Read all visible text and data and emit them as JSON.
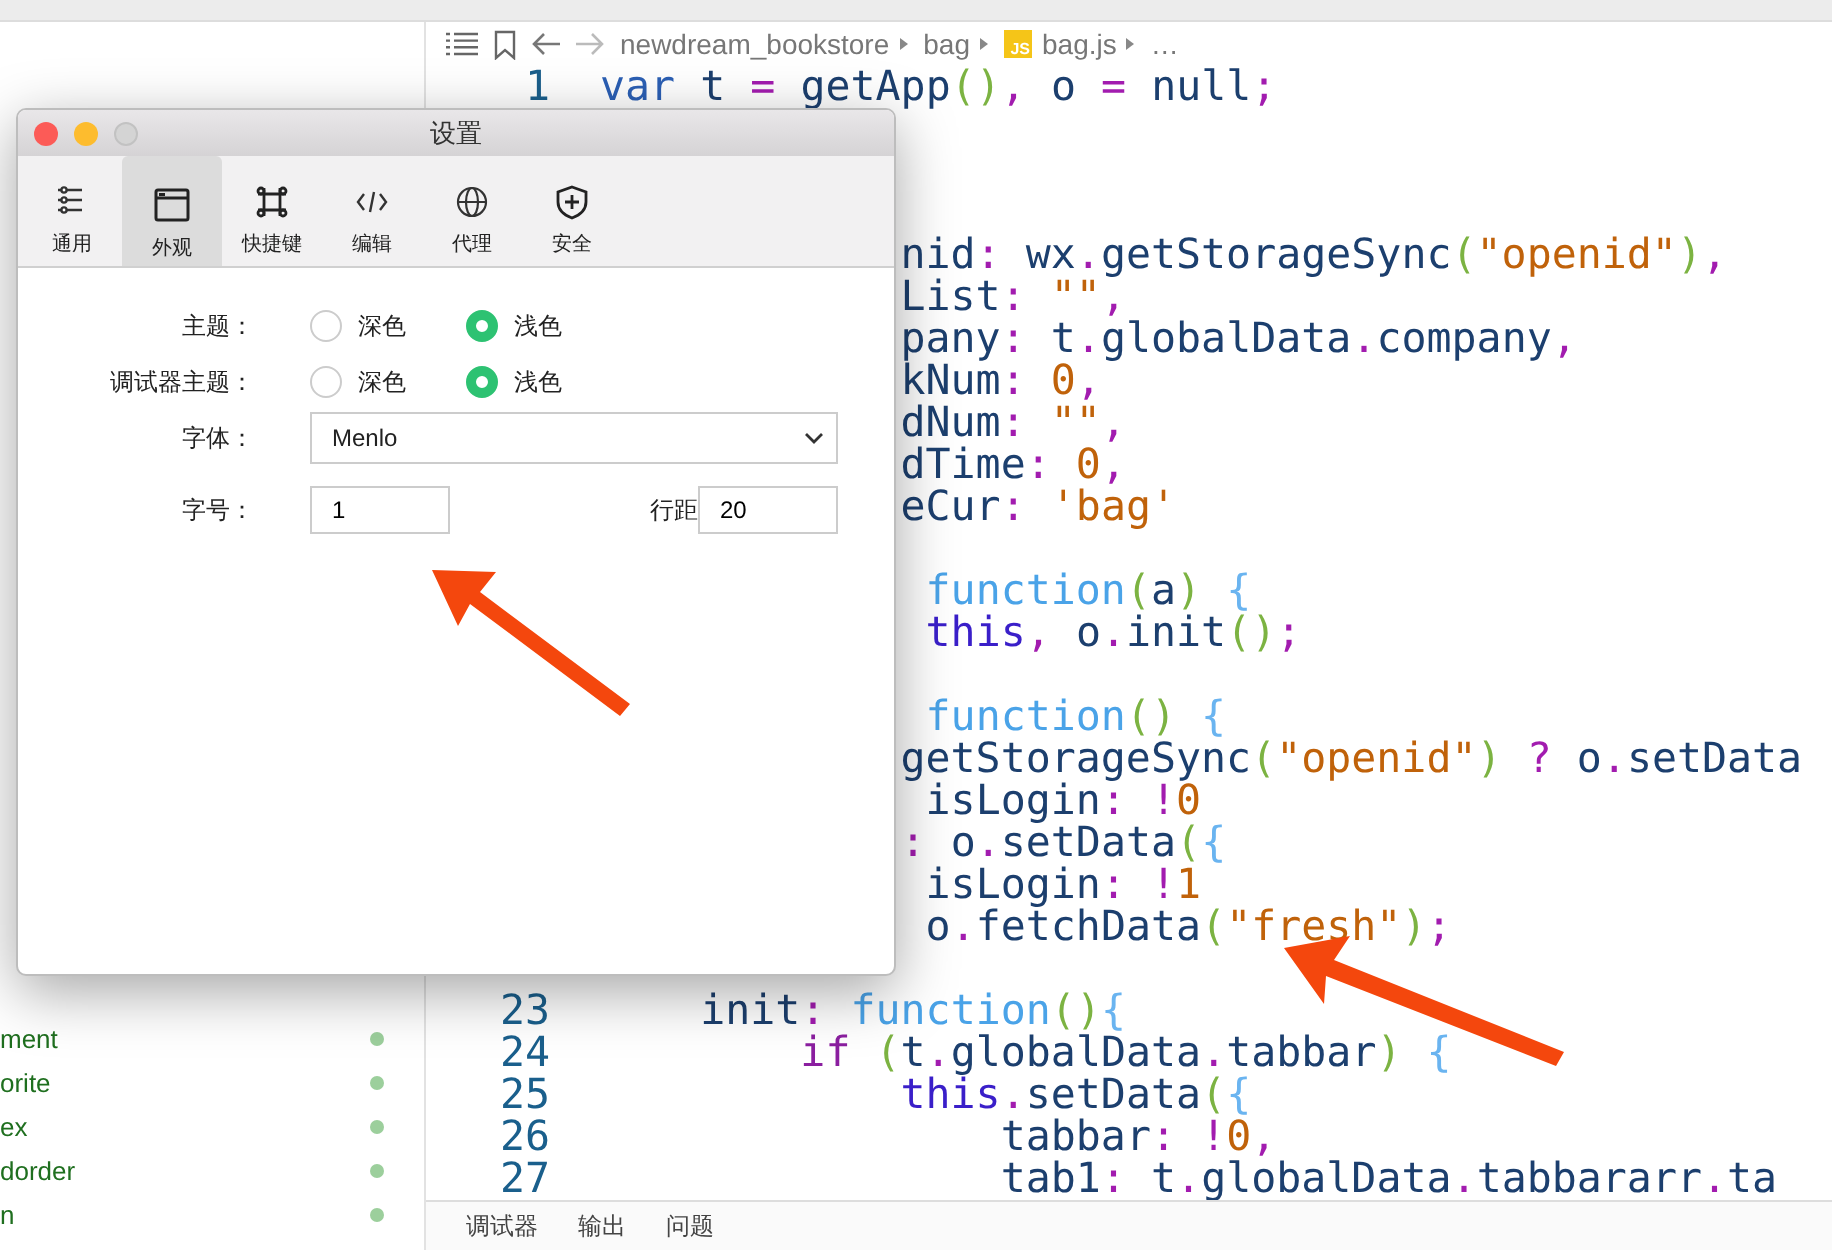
{
  "breadcrumb": [
    {
      "kind": "folder",
      "text": "newdream_bookstore"
    },
    {
      "kind": "folder",
      "text": "bag"
    },
    {
      "kind": "file",
      "text": "bag.js",
      "badge": "JS"
    },
    {
      "kind": "more",
      "text": "…"
    }
  ],
  "editor": {
    "lines": [
      {
        "kind": "code",
        "number": "1",
        "text": "var t = getApp(), o = null;"
      },
      {
        "kind": "blank"
      },
      {
        "kind": "blank"
      },
      {
        "kind": "blank"
      },
      {
        "kind": "code",
        "text": "            nid: wx.getStorageSync(\"openid\"),"
      },
      {
        "kind": "code",
        "text": "            List: \"\","
      },
      {
        "kind": "code",
        "text": "            pany: t.globalData.company,"
      },
      {
        "kind": "code",
        "text": "            kNum: 0,"
      },
      {
        "kind": "code",
        "text": "            dNum: \"\","
      },
      {
        "kind": "code",
        "text": "            dTime: 0,"
      },
      {
        "kind": "code",
        "text": "            eCur: 'bag'"
      },
      {
        "kind": "blank"
      },
      {
        "kind": "code",
        "text": "             function(a) {"
      },
      {
        "kind": "code",
        "text": "             this, o.init();"
      },
      {
        "kind": "blank"
      },
      {
        "kind": "code",
        "text": "             function() {"
      },
      {
        "kind": "code",
        "text": "            getStorageSync(\"openid\") ? o.setData"
      },
      {
        "kind": "code",
        "text": "             isLogin: !0"
      },
      {
        "kind": "code",
        "text": "            : o.setData({"
      },
      {
        "kind": "code",
        "text": "             isLogin: !1"
      },
      {
        "kind": "code",
        "text": "             o.fetchData(\"fresh\");"
      },
      {
        "kind": "blank"
      },
      {
        "kind": "code",
        "number": "23",
        "text": "    init: function(){"
      },
      {
        "kind": "code",
        "number": "24",
        "text": "        if (t.globalData.tabbar) {"
      },
      {
        "kind": "code",
        "number": "25",
        "text": "            this.setData({"
      },
      {
        "kind": "code",
        "number": "26",
        "text": "                tabbar: !0,"
      },
      {
        "kind": "code",
        "number": "27",
        "text": "                tab1: t.globalData.tabbararr.ta"
      }
    ]
  },
  "sidebar": {
    "items": [
      {
        "label": "ment"
      },
      {
        "label": "orite"
      },
      {
        "label": "ex"
      },
      {
        "label": "dorder"
      },
      {
        "label": "n"
      }
    ]
  },
  "bottom_panel": {
    "tabs": [
      {
        "label": "调试器"
      },
      {
        "label": "输出"
      },
      {
        "label": "问题"
      }
    ]
  },
  "settings_dialog": {
    "title": "设置",
    "tabs": [
      {
        "label": "通用",
        "kind": "sliders",
        "selected": false
      },
      {
        "label": "外观",
        "kind": "window",
        "selected": true
      },
      {
        "label": "快捷键",
        "kind": "command",
        "selected": false
      },
      {
        "label": "编辑",
        "kind": "code",
        "selected": false
      },
      {
        "label": "代理",
        "kind": "globe",
        "selected": false
      },
      {
        "label": "安全",
        "kind": "shield",
        "selected": false
      }
    ],
    "rows": [
      {
        "kind": "radio",
        "label": "主题：",
        "options": [
          {
            "label": "深色",
            "selected": false
          },
          {
            "label": "浅色",
            "selected": true
          }
        ]
      },
      {
        "kind": "radio",
        "label": "调试器主题：",
        "options": [
          {
            "label": "深色",
            "selected": false
          },
          {
            "label": "浅色",
            "selected": true
          }
        ]
      },
      {
        "kind": "select",
        "label": "字体：",
        "value": "Menlo"
      },
      {
        "kind": "inputs",
        "fields": [
          {
            "label": "字号：",
            "value": "1"
          },
          {
            "label": "行距",
            "value": "20"
          }
        ]
      }
    ]
  }
}
